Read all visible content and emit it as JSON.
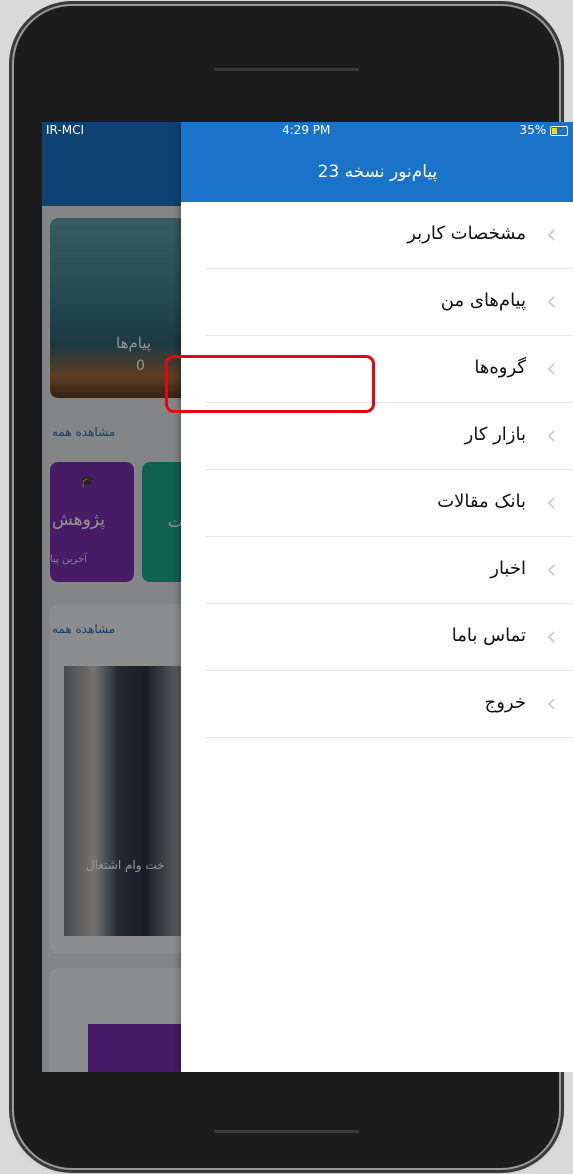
{
  "status_bar": {
    "carrier": "IR-MCI",
    "time": "4:29 PM",
    "battery": "35%"
  },
  "background_app": {
    "messages_label": "پیام‌ها",
    "messages_count": "0",
    "see_all_1": "مشاهده همه",
    "research_label": "پژوهش",
    "research_sub": "آخرین پیا",
    "see_all_2": "مشاهده همه",
    "news_caption": "خت وام اشتغال"
  },
  "drawer": {
    "title": "پیام‌نور نسخه 23",
    "items": [
      {
        "label": "مشخصات کاربر"
      },
      {
        "label": "پیام‌های من"
      },
      {
        "label": "گروه‌ها"
      },
      {
        "label": "بازار کار"
      },
      {
        "label": "بانک مقالات"
      },
      {
        "label": "اخبار"
      },
      {
        "label": "تماس باما"
      },
      {
        "label": "خروج"
      }
    ]
  },
  "highlight_color": "#e30613",
  "accent_color": "#1a73c9"
}
